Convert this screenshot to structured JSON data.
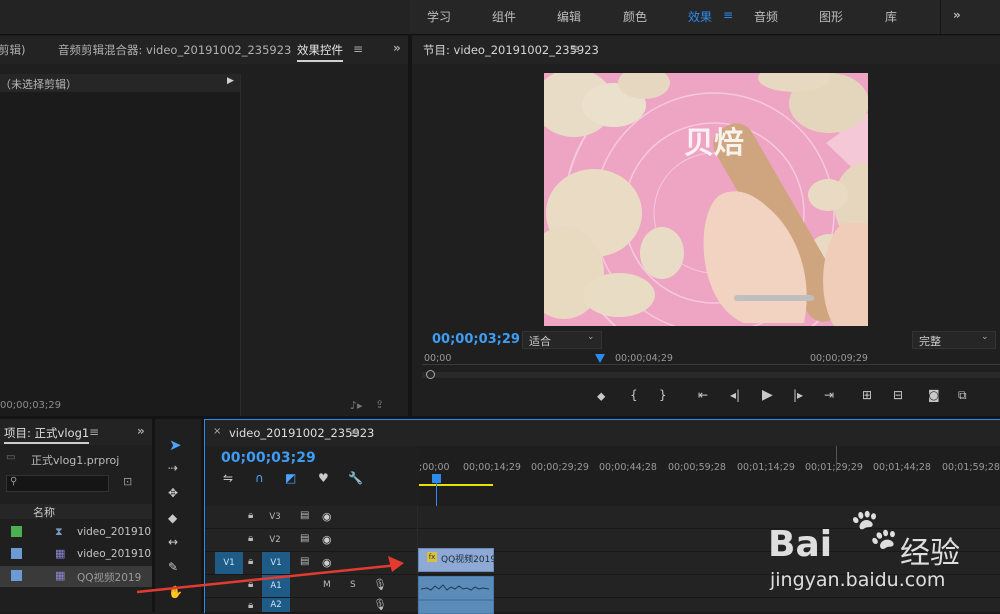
{
  "workspace": {
    "tabs": [
      "学习",
      "组件",
      "编辑",
      "颜色",
      "效果",
      "音频",
      "图形",
      "库"
    ],
    "active_tab": "效果",
    "overflow": "»"
  },
  "left_panel": {
    "tab_source": "剪辑)",
    "tab_mixer": "音频剪辑混合器: video_20191002_235923",
    "tab_effects": "效果控件",
    "no_clip": "（未选择剪辑）",
    "timecode": "00;00;03;29"
  },
  "program": {
    "title": "节目: video_20191002_235923",
    "timecode": "00;00;03;29",
    "fit": "适合",
    "quality": "完整",
    "ruler": [
      "00;00",
      "00;00;04;29",
      "00;00;09;29"
    ]
  },
  "project": {
    "title": "项目: 正式vlog1",
    "file": "正式vlog1.prproj",
    "col_name": "名称",
    "items": [
      {
        "name": "video_201910",
        "color": "#4caf50"
      },
      {
        "name": "video_201910",
        "color": "#6b9bd2"
      },
      {
        "name": "QQ视频2019",
        "color": "#6b9bd2"
      }
    ]
  },
  "timeline": {
    "tab": "video_20191002_235923",
    "timecode": "00;00;03;29",
    "ruler": [
      ";00;00",
      "00;00;14;29",
      "00;00;29;29",
      "00;00;44;28",
      "00;00;59;28",
      "00;01;14;29",
      "00;01;29;29",
      "00;01;44;28",
      "00;01;59;28"
    ],
    "tracks": [
      "V3",
      "V2",
      "V1",
      "A1",
      "A2"
    ],
    "src_v": "V1",
    "src_a": "A1",
    "m": "M",
    "s": "S",
    "clip": "QQ视频2019",
    "fx": "fx"
  },
  "watermark": {
    "brand": "Bai",
    "cn": "经验",
    "url": "jingyan.baidu.com"
  }
}
